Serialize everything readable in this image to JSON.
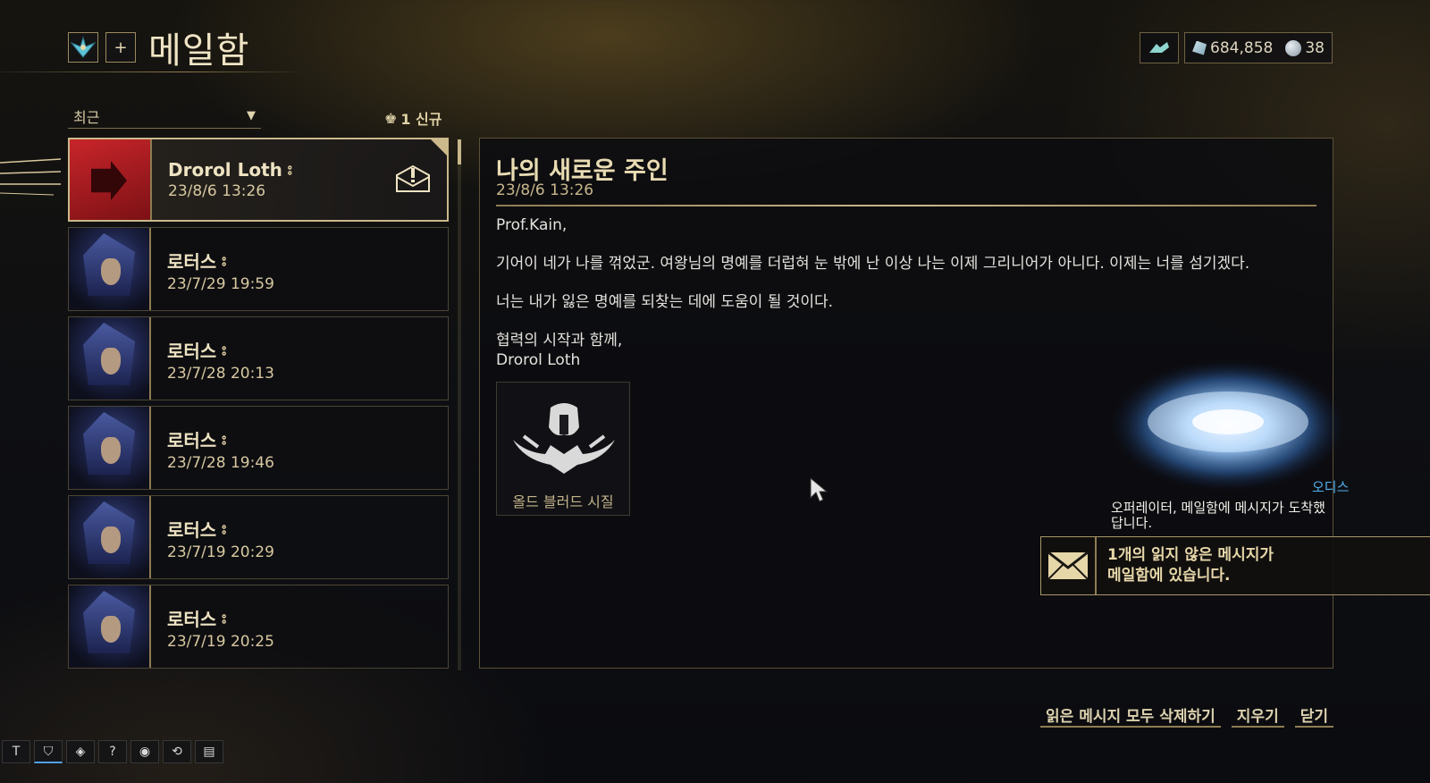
{
  "header": {
    "title": "메일함",
    "add_label": "+"
  },
  "wallet": {
    "platinum": "684,858",
    "credits": "38"
  },
  "filter": {
    "sort_label": "최근",
    "new_label": "1 신규"
  },
  "mails": [
    {
      "sender": "Drorol Loth",
      "date": "23/8/6 13:26",
      "icon": "drorol-emblem-icon"
    },
    {
      "sender": "로터스",
      "date": "23/7/29 19:59",
      "icon": "lotus-portrait"
    },
    {
      "sender": "로터스",
      "date": "23/7/28 20:13",
      "icon": "lotus-portrait"
    },
    {
      "sender": "로터스",
      "date": "23/7/28 19:46",
      "icon": "lotus-portrait"
    },
    {
      "sender": "로터스",
      "date": "23/7/19 20:29",
      "icon": "lotus-portrait"
    },
    {
      "sender": "로터스",
      "date": "23/7/19 20:25",
      "icon": "lotus-portrait"
    }
  ],
  "reader": {
    "subject": "나의 새로운 주인",
    "date": "23/8/6 13:26",
    "salutation": "Prof.Kain,",
    "paragraph1": "기어이 네가 나를 꺾었군. 여왕님의 명예를 더럽혀 눈 밖에 난 이상 나는 이제 그리니어가 아니다. 이제는 너를 섬기겠다.",
    "paragraph2": "너는 내가 잃은 명예를 되찾는 데에 도움이 될 것이다.",
    "closing": "협력의 시작과 함께,",
    "signature": "Drorol Loth",
    "attachment": "올드 블러드 시질"
  },
  "companion": {
    "name": "오디스",
    "message": "오퍼레이터, 메일함에 메시지가 도착했답니다."
  },
  "toast": {
    "line1": "1개의 읽지 않은 메시지가",
    "line2": "메일함에 있습니다."
  },
  "actions": {
    "delete_read": "읽은 메시지 모두 삭제하기",
    "delete": "지우기",
    "close": "닫기"
  },
  "taskbar": {
    "t_label": "T",
    "help_label": "?"
  }
}
